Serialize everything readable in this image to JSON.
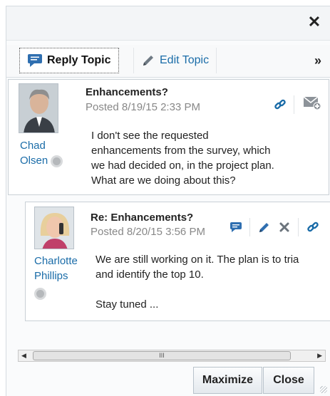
{
  "dialog": {
    "close_glyph": "✕",
    "toolbar": {
      "reply_label": "Reply Topic",
      "edit_label": "Edit Topic",
      "more_glyph": "»"
    },
    "topic": {
      "author_first": "Chad",
      "author_last": "Olsen",
      "subject": "Enhancements?",
      "posted": "Posted 8/19/15 2:33 PM",
      "body": "I don't see the requested\nenhancements from the survey, which\nwe had decided on, in the project plan.\nWhat are we doing about this?"
    },
    "reply": {
      "author_first": "Charlotte",
      "author_last": "Phillips",
      "subject": "Re: Enhancements?",
      "posted": "Posted 8/20/15 3:56 PM",
      "body": "We are still working on it. The plan is to tria\nand identify the top 10.\n\nStay tuned ..."
    },
    "scrollbar": {
      "left_arrow": "◀",
      "right_arrow": "▶",
      "thumb_grip": "III"
    },
    "footer": {
      "maximize_label": "Maximize",
      "close_label": "Close"
    }
  },
  "colors": {
    "link_blue": "#1a6ca8",
    "border": "#c9d0d6"
  }
}
